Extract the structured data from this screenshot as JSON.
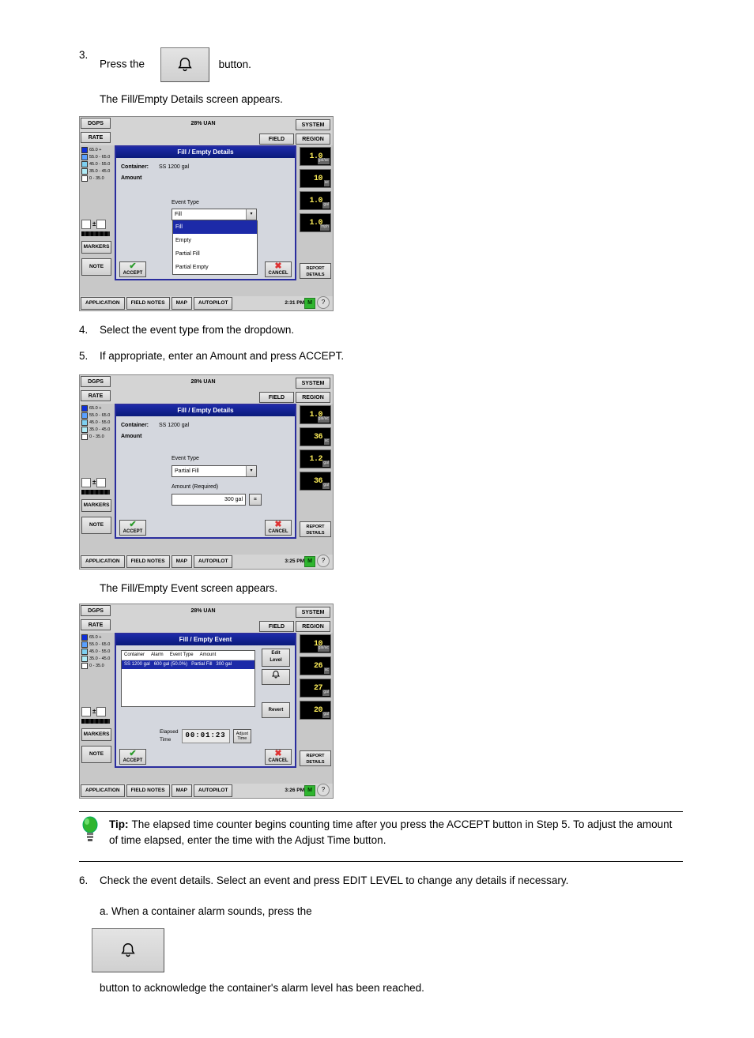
{
  "step3": {
    "num": "3.",
    "textA": "Press the",
    "button_name": "alarm-button",
    "textB": "button."
  },
  "caption3": "The Fill/Empty Details screen appears.",
  "shot_common": {
    "dgps": "DGPS",
    "system": "SYSTEM",
    "rate": "RATE",
    "field": "FIELD",
    "region": "REGION",
    "title_mid": "28% UAN",
    "markers": "MARKERS",
    "note": "NOTE",
    "report": "REPORT\nDETAILS",
    "bottom": {
      "application": "APPLICATION",
      "fieldnotes": "FIELD NOTES",
      "map": "MAP",
      "autopilot": "AUTOPILOT"
    },
    "m": "M",
    "help": "?",
    "legend": [
      {
        "c": "#1030d8",
        "t": "65.0 +"
      },
      {
        "c": "#5aa0ff",
        "t": "55.0 - 65.0"
      },
      {
        "c": "#7ecff0",
        "t": "45.0 - 55.0"
      },
      {
        "c": "#b0ecf7",
        "t": "35.0 - 45.0"
      },
      {
        "c": "#ffffff",
        "t": "0 - 35.0"
      }
    ],
    "accept": "ACCEPT",
    "cancel": "CANCEL"
  },
  "shot1": {
    "modal_title": "Fill / Empty Details",
    "container_lbl": "Container:",
    "container_val": "SS 1200 gal",
    "amount_lbl": "Amount",
    "eventtype_lbl": "Event Type",
    "select_val": "Fill",
    "options": [
      "Fill",
      "Empty",
      "Partial Fill",
      "Partial Empty"
    ],
    "gauges": [
      {
        "v": "1.0",
        "u": "gal/ac"
      },
      {
        "v": "10",
        "u": "ac"
      },
      {
        "v": "1.0",
        "u": "gal"
      },
      {
        "v": "1.0",
        "u": "mph"
      }
    ],
    "clock": "2:31 PM"
  },
  "step4": {
    "num": "4.",
    "text": "Select the event type from the dropdown."
  },
  "step5": {
    "num": "5.",
    "text": "If appropriate, enter an Amount and press ACCEPT."
  },
  "shot2": {
    "modal_title": "Fill / Empty Details",
    "container_lbl": "Container:",
    "container_val": "SS 1200 gal",
    "amount_lbl": "Amount",
    "eventtype_lbl": "Event Type",
    "select_val": "Partial Fill",
    "amount_req_lbl": "Amount (Required)",
    "amount_req_val": "300 gal",
    "gauges": [
      {
        "v": "1.0",
        "u": "gal/ac"
      },
      {
        "v": "36",
        "u": "ac"
      },
      {
        "v": "1.2",
        "u": "gal"
      },
      {
        "v": "36",
        "u": "gal"
      }
    ],
    "clock": "3:25 PM"
  },
  "caption5": "The Fill/Empty Event screen appears.",
  "shot3": {
    "modal_title": "Fill / Empty Event",
    "hdr": {
      "container": "Container",
      "alarm": "Alarm",
      "eventtype": "Event Type",
      "amount": "Amount"
    },
    "row": {
      "container": "SS 1200 gal",
      "alarm": "600 gal (50.0%)",
      "eventtype": "Partial Fill",
      "amount": "300 gal"
    },
    "edit_level": "Edit\nLevel",
    "bell": "bell",
    "revert": "Revert",
    "elapsed_lbl": "Elapsed Time",
    "elapsed_val": "00:01:23",
    "adjust": "Adjust\nTime",
    "gauges": [
      {
        "v": "10",
        "u": "gal/ac"
      },
      {
        "v": "26",
        "u": "ac"
      },
      {
        "v": "27",
        "u": "gal"
      },
      {
        "v": "20",
        "u": "gal"
      }
    ],
    "clock": "3:26 PM"
  },
  "tip": {
    "label": "Tip:",
    "text": "The elapsed time counter begins counting time after you press the ACCEPT button in Step 5. To adjust the amount of time elapsed, enter the time with the Adjust Time button."
  },
  "step6": {
    "num": "6.",
    "text": "Check the event details. Select an event and press EDIT LEVEL to change any details if necessary.",
    "sub_a_pre": "a.  When a container alarm sounds, press the",
    "sub_a_post": "button to acknowledge the container's alarm level has been reached."
  }
}
